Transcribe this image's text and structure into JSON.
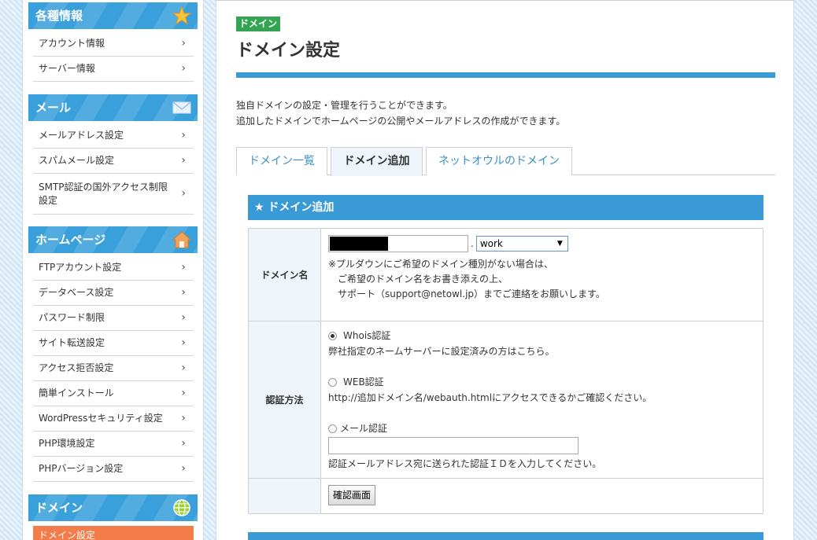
{
  "colors": {
    "accent": "#3a9ad6",
    "active_item": "#f27d4a",
    "badge": "#33a552"
  },
  "sidebar": {
    "sections": [
      {
        "title": "各種情報",
        "icon": "star-icon",
        "items": [
          "アカウント情報",
          "サーバー情報"
        ]
      },
      {
        "title": "メール",
        "icon": "mail-icon",
        "items": [
          "メールアドレス設定",
          "スパムメール設定",
          "SMTP認証の国外アクセス制限設定"
        ]
      },
      {
        "title": "ホームページ",
        "icon": "house-icon",
        "items": [
          "FTPアカウント設定",
          "データベース設定",
          "パスワード制限",
          "サイト転送設定",
          "アクセス拒否設定",
          "簡単インストール",
          "WordPressセキュリティ設定",
          "PHP環境設定",
          "PHPバージョン設定"
        ]
      },
      {
        "title": "ドメイン",
        "icon": "globe-icon",
        "items": [
          "ドメイン設定"
        ]
      }
    ]
  },
  "main": {
    "badge": "ドメイン",
    "title": "ドメイン設定",
    "desc_line1": "独自ドメインの設定・管理を行うことができます。",
    "desc_line2": "追加したドメインでホームページの公開やメールアドレスの作成ができます。",
    "tabs": [
      "ドメイン一覧",
      "ドメイン追加",
      "ネットオウルのドメイン"
    ],
    "active_tab": "ドメイン追加",
    "section_title": "ドメイン追加",
    "form": {
      "domain_label": "ドメイン名",
      "tld_value": "work",
      "note_line1": "※プルダウンにご希望のドメイン種別がない場合は、",
      "note_line2": "ご希望のドメイン名をお書き添えの上、",
      "note_line3": "サポート（support@netowl.jp）までご連絡をお願いします。",
      "auth_label": "認証方法",
      "whois_label": "Whois認証",
      "whois_desc": "弊社指定のネームサーバーに設定済みの方はこちら。",
      "web_label": "WEB認証",
      "web_desc": "http://追加ドメイン名/webauth.htmlにアクセスできるかご確認ください。",
      "mail_label": "メール認証",
      "mail_desc": "認証メールアドレス宛に送られた認証ＩＤを入力してください。",
      "confirm_button": "確認画面"
    }
  }
}
